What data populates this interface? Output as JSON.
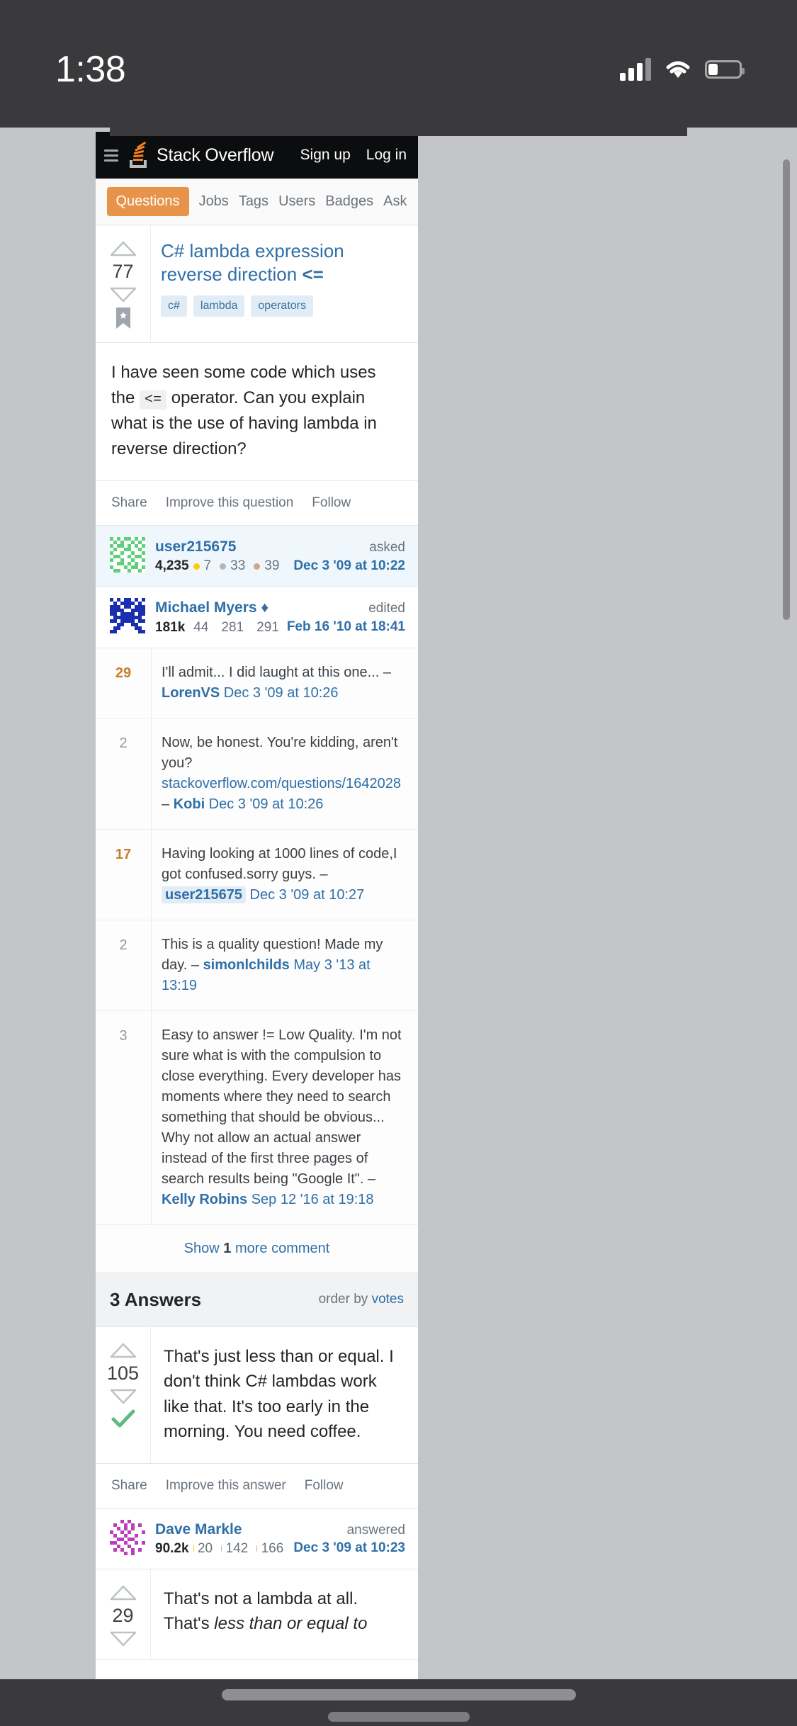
{
  "status_bar": {
    "time": "1:38",
    "signal_icon": "cellular-signal-icon",
    "wifi_icon": "wifi-icon",
    "battery_icon": "battery-icon"
  },
  "site": {
    "name": "Stack Overflow",
    "menu_icon": "hamburger-menu-icon",
    "logo_icon": "stack-overflow-logo-icon",
    "sign_up": "Sign up",
    "log_in": "Log in"
  },
  "nav": {
    "items": [
      {
        "label": "Questions",
        "active": true
      },
      {
        "label": "Jobs",
        "active": false
      },
      {
        "label": "Tags",
        "active": false
      },
      {
        "label": "Users",
        "active": false
      },
      {
        "label": "Badges",
        "active": false
      },
      {
        "label": "Ask",
        "active": false
      }
    ]
  },
  "question": {
    "votes": "77",
    "title_line1": "C# lambda expression reverse direction",
    "title_line2": "<=",
    "tags": [
      "c#",
      "lambda",
      "operators"
    ],
    "body_part1": "I have seen some code which uses the",
    "body_code": "<=",
    "body_part2": "operator. Can you explain what is the use of having lambda in reverse direction?",
    "actions": [
      "Share",
      "Improve this question",
      "Follow"
    ],
    "upvote_icon": "upvote-arrow-icon",
    "downvote_icon": "downvote-arrow-icon",
    "bookmark_icon": "bookmark-icon"
  },
  "asker": {
    "name": "user215675",
    "reputation": "4,235",
    "gold": "7",
    "silver": "33",
    "bronze": "39",
    "action_label": "asked",
    "date": "Dec 3 '09 at 10:22",
    "avatar_icon": "identicon-avatar-green"
  },
  "editor": {
    "name": "Michael Myers",
    "mod_diamond": "♦",
    "reputation": "181k",
    "gold": "44",
    "silver": "281",
    "bronze": "291",
    "action_label": "edited",
    "date": "Feb 16 '10 at 18:41",
    "avatar_icon": "identicon-avatar-blue"
  },
  "comments": [
    {
      "score": "29",
      "hot": true,
      "text": "I'll admit... I did laught at this one... – ",
      "author": "LorenVS",
      "date": " Dec 3 '09 at 10:26"
    },
    {
      "score": "2",
      "hot": false,
      "text": "Now, be honest. You're kidding, aren't you? ",
      "link": "stackoverflow.com/questions/1642028",
      "text2": " – ",
      "author": "Kobi",
      "date": " Dec 3 '09 at 10:26"
    },
    {
      "score": "17",
      "hot": true,
      "text": "Having looking at 1000 lines of code,I got confused.sorry guys. – ",
      "author": "user215675",
      "highlight": true,
      "date": " Dec 3 '09 at 10:27"
    },
    {
      "score": "2",
      "hot": false,
      "text": "This is a quality question! Made my day. – ",
      "author": "simonlchilds",
      "date": " May 3 '13 at 13:19"
    },
    {
      "score": "3",
      "hot": false,
      "text": "Easy to answer != Low Quality. I'm not sure what is with the compulsion to close everything. Every developer has moments where they need to search something that should be obvious... Why not allow an actual answer instead of the first three pages of search results being \"Google It\". – ",
      "author": "Kelly Robins",
      "date": " Sep 12 '16 at 19:18"
    }
  ],
  "show_more": {
    "prefix": "Show ",
    "count": "1",
    "suffix": " more comment"
  },
  "answers_header": {
    "count_label": "3 Answers",
    "order_prefix": "order by ",
    "order_link": "votes"
  },
  "answers": [
    {
      "votes": "105",
      "accepted": true,
      "accept_icon": "accepted-checkmark-icon",
      "body": "That's just less than or equal. I don't think C# lambdas work like that. It's too early in the morning. You need coffee.",
      "actions": [
        "Share",
        "Improve this answer",
        "Follow"
      ],
      "author": {
        "name": "Dave Markle",
        "reputation": "90.2k",
        "gold": "20",
        "silver": "142",
        "bronze": "166",
        "action_label": "answered",
        "date": "Dec 3 '09 at 10:23",
        "avatar_icon": "identicon-avatar-purple"
      }
    },
    {
      "votes": "29",
      "accepted": false,
      "body_part1": "That's not a lambda at all. That's ",
      "body_em": "less than or equal to",
      "actions": [],
      "author": null
    }
  ],
  "colors": {
    "accent_orange": "#e8934a",
    "link_blue": "#2f6fa8",
    "topbar_black": "#0c0d0e",
    "tag_bg": "#e1ecf4",
    "accepted_green": "#5eba7d"
  }
}
